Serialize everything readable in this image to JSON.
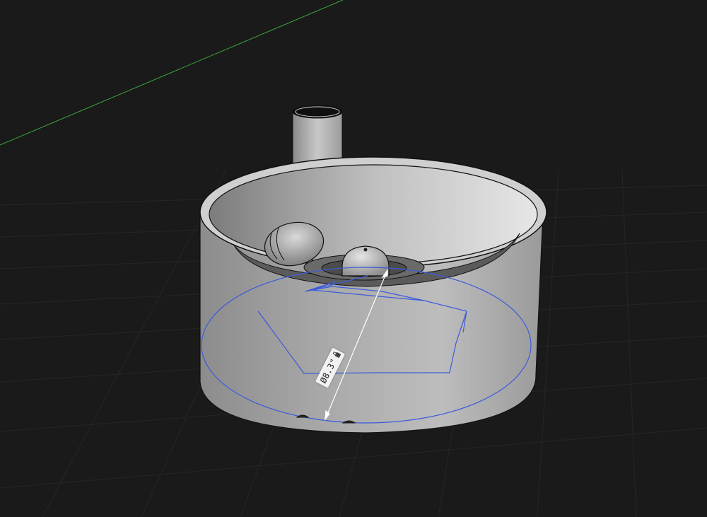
{
  "dimension": {
    "value_text": "Ø8.3\"",
    "lock_icon": "lock-icon"
  },
  "colors": {
    "background": "#1a1a1a",
    "grid_line": "#262626",
    "axis_green": "#3aa63a",
    "selection_blue": "#3b5bdb",
    "dimension_line": "#ffffff"
  }
}
